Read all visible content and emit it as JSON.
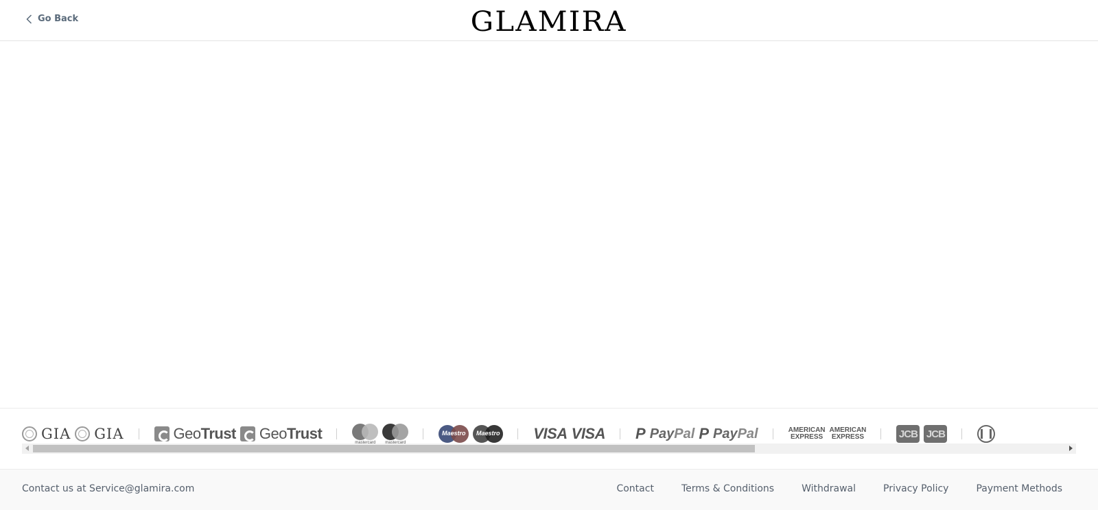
{
  "header": {
    "go_back_label": "Go Back",
    "logo_text": "GLAMIRA"
  },
  "badges": {
    "gia": "GIA",
    "geotrust_light": "Geo",
    "geotrust_bold": "Trust",
    "mastercard_label": "mastercard",
    "maestro_label": "Maestro",
    "visa": "VISA",
    "paypal_pay": "Pay",
    "paypal_pal": "Pal",
    "amex_line1": "AMERICAN",
    "amex_line2": "EXPRESS",
    "jcb": "JCB",
    "icons": [
      "gia-logo",
      "geotrust-logo",
      "mastercard-logo",
      "maestro-logo",
      "visa-logo",
      "paypal-logo",
      "american-express-logo",
      "jcb-logo",
      "diners-club-logo"
    ]
  },
  "footer": {
    "contact_text": "Contact us at Service@glamira.com",
    "links": [
      "Contact",
      "Terms & Conditions",
      "Withdrawal",
      "Privacy Policy",
      "Payment Methods"
    ]
  },
  "colors": {
    "text": "#555f6c",
    "footer_bg": "#f9f9f9",
    "divider": "#e3e3e3"
  }
}
